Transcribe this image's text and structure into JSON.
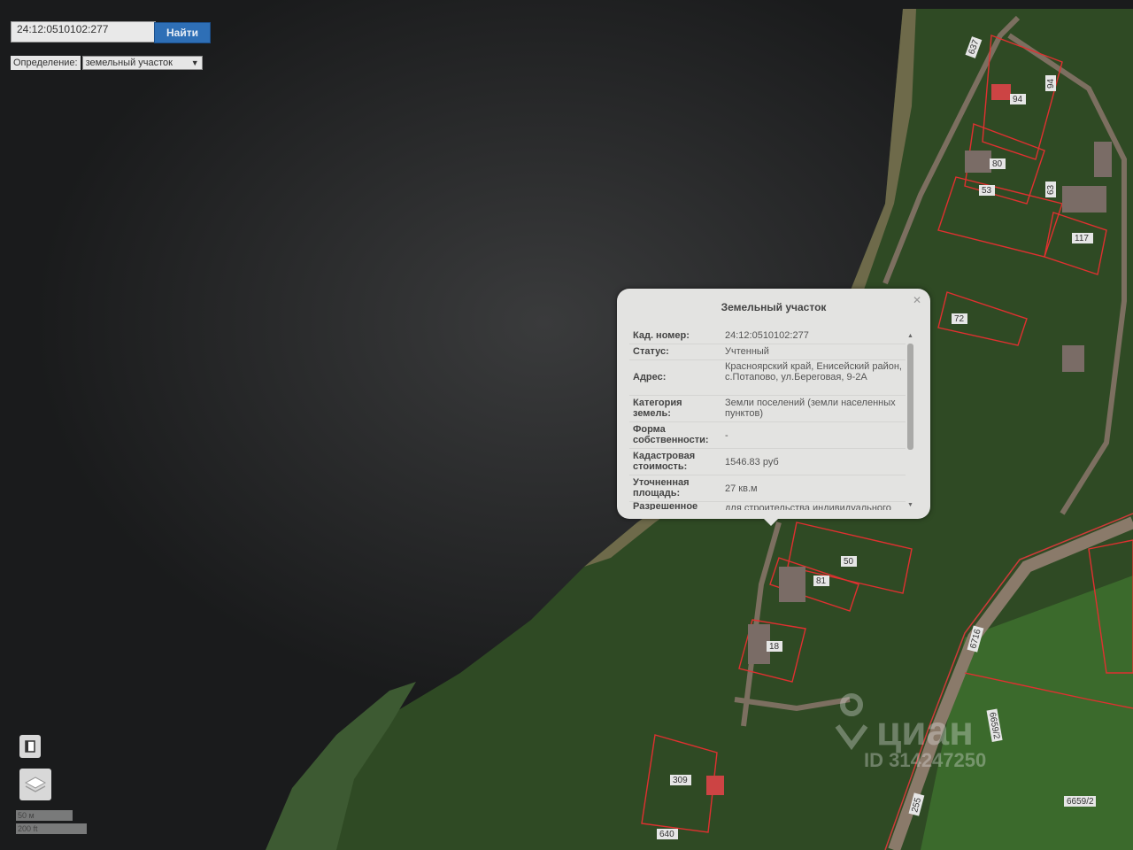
{
  "search": {
    "value": "24:12:0510102:277",
    "button_label": "Найти"
  },
  "definition": {
    "label": "Определение:",
    "selected": "земельный участок"
  },
  "scale": {
    "line1": "50 м",
    "line2": "200 ft"
  },
  "popup": {
    "title": "Земельный участок",
    "rows": [
      {
        "key": "Кад. номер:",
        "value": "24:12:0510102:277"
      },
      {
        "key": "Статус:",
        "value": "Учтенный"
      },
      {
        "key": "Адрес:",
        "value": "Красноярский край, Енисейский район, с.Потапово, ул.Береговая, 9-2А"
      },
      {
        "key": "Категория земель:",
        "value": "Земли поселений (земли населенных пунктов)"
      },
      {
        "key": "Форма собственности:",
        "value": "-"
      },
      {
        "key": "Кадастровая стоимость:",
        "value": "1546.83 руб"
      },
      {
        "key": "Уточненная площадь:",
        "value": "27 кв.м"
      },
      {
        "key": "Разрешенное",
        "value": "для строительства индивидуального"
      }
    ]
  },
  "parcel_labels": [
    "637",
    "94",
    "94",
    "80",
    "53",
    "63",
    "117",
    "72",
    "50",
    "81",
    "18",
    "309",
    "640",
    "6716",
    "6659/2",
    "6659/2",
    "255"
  ],
  "watermark": {
    "brand": "циан",
    "id": "ID 314247250"
  }
}
